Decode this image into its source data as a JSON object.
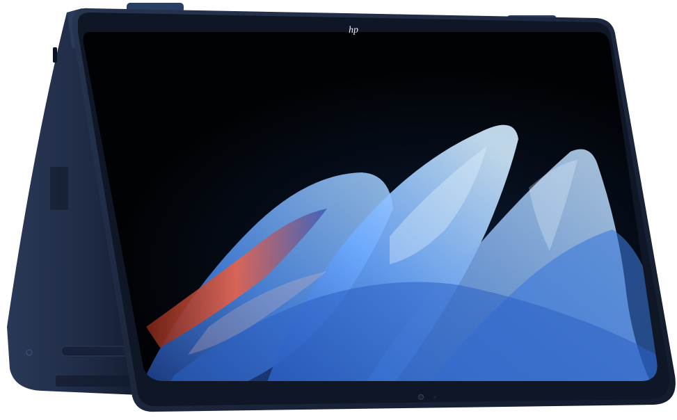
{
  "product": {
    "logo_text": "hp",
    "colors": {
      "chassis": "#1e2b45",
      "chassis_dark": "#141d31",
      "bezel": "#0f1626",
      "screen": "#020305",
      "wave_blue": "#4f8ff0",
      "wave_light": "#bfe2ff",
      "wave_red": "#e7624b",
      "background": "#ffffff"
    }
  }
}
